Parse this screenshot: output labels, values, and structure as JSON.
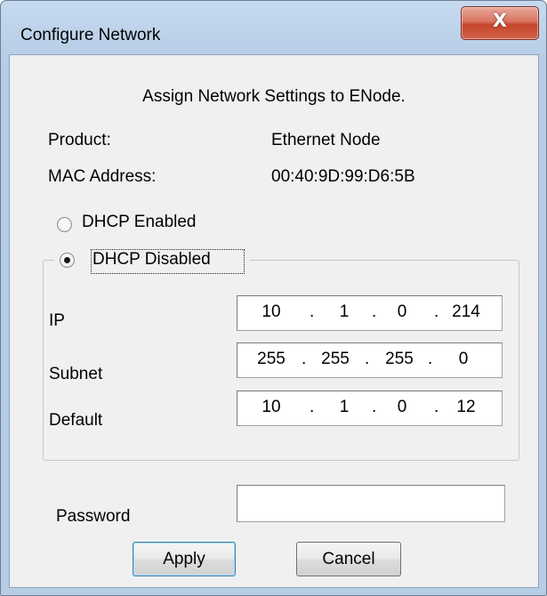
{
  "window": {
    "title": "Configure Network",
    "close_glyph": "X"
  },
  "heading": "Assign Network Settings to ENode.",
  "info": {
    "product_label": "Product:",
    "product_value": "Ethernet Node",
    "mac_label": "MAC Address:",
    "mac_value": "00:40:9D:99:D6:5B"
  },
  "dhcp": {
    "enabled_label": "DHCP Enabled",
    "disabled_label": "DHCP Disabled",
    "selected": "disabled"
  },
  "network": {
    "ip": {
      "label": "IP",
      "octets": [
        "10",
        "1",
        "0",
        "214"
      ]
    },
    "subnet": {
      "label": "Subnet",
      "octets": [
        "255",
        "255",
        "255",
        "0"
      ]
    },
    "default": {
      "label": "Default",
      "octets": [
        "10",
        "1",
        "0",
        "12"
      ]
    }
  },
  "password": {
    "label": "Password",
    "value": ""
  },
  "buttons": {
    "apply": "Apply",
    "cancel": "Cancel"
  }
}
